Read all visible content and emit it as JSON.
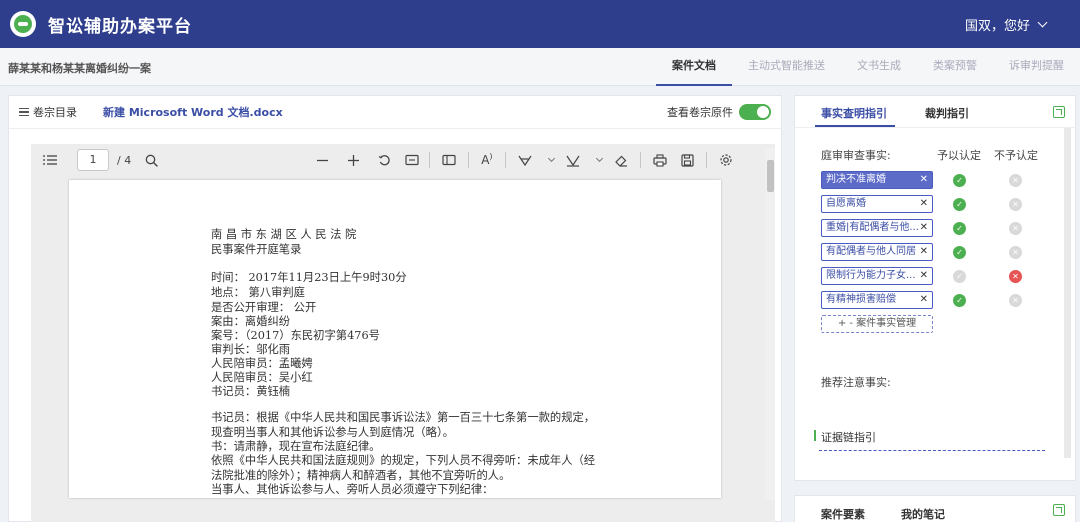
{
  "app": {
    "title": "智讼辅助办案平台",
    "user_greeting": "国双，您好"
  },
  "case_title": "薛某某和杨某某离婚纠纷一案",
  "nav_tabs": [
    "案件文档",
    "主动式智能推送",
    "文书生成",
    "类案预警",
    "诉审判提醒"
  ],
  "doc_toolbar": {
    "dir_label": "卷宗目录",
    "file_tab": "新建 Microsoft Word 文档.docx",
    "view_original_label": "查看卷宗原件",
    "view_original_on": true
  },
  "pdf_viewer": {
    "page_current": "1",
    "page_total": "/ 4",
    "tools": [
      "sidebar-toggle",
      "search",
      "zoom-out",
      "zoom-in",
      "rotate",
      "fit-width",
      "page-view",
      "text-size",
      "highlight-pen",
      "draw-pen",
      "eraser",
      "print",
      "save",
      "settings"
    ]
  },
  "document": {
    "lines": [
      "南 昌 市 东 湖 区 人 民 法 院",
      "民事案件开庭笔录",
      "时间：  2017年11月23日上午9时30分",
      "地点：  第八审判庭",
      "是否公开审理：  公开",
      "案由：离婚纠纷",
      "案号：（2017）东民初字第476号",
      "审判长：邬化雨",
      "人民陪审员：孟曦娉",
      "人民陪审员：吴小红",
      "书记员：黄钰楠",
      "书记员：根据《中华人民共和国民事诉讼法》第一百三十七条第一款的规定，",
      "现查明当事人和其他诉讼参与人到庭情况（略）。",
      "书：请肃静，现在宣布法庭纪律。",
      "依照《中华人民共和国法庭规则》的规定，下列人员不得旁听：未成年人（经",
      "法院批准的除外）；精神病人和醉酒者，其他不宜旁听的人。",
      "当事人、其他诉讼参与人、旁听人员必须遵守下列纪律："
    ]
  },
  "right_panel": {
    "tabs": [
      "事实查明指引",
      "裁判指引"
    ],
    "facts_label": "庭审审查事实:",
    "col_accept": "予以认定",
    "col_reject": "不予认定",
    "facts": [
      {
        "label": "判决不准离婚",
        "selected": true,
        "accept": true,
        "reject": false
      },
      {
        "label": "自愿离婚",
        "selected": false,
        "accept": true,
        "reject": false
      },
      {
        "label": "重婚|有配偶者与他...",
        "selected": false,
        "accept": true,
        "reject": false
      },
      {
        "label": "有配偶者与他人同居",
        "selected": false,
        "accept": true,
        "reject": false
      },
      {
        "label": "限制行为能力子女...",
        "selected": false,
        "accept": false,
        "reject": true
      },
      {
        "label": "有精神损害赔偿",
        "selected": false,
        "accept": true,
        "reject": false
      }
    ],
    "add_label": "+ - 案件事实管理",
    "recommend_label": "推荐注意事实:",
    "evidence_label": "证据链指引"
  },
  "bottom_panel": {
    "tabs": [
      "案件要素",
      "我的笔记"
    ]
  },
  "colors": {
    "header": "#2e3e8c",
    "accent": "#3b4ea5",
    "green": "#4caf50",
    "red": "#e65454"
  }
}
